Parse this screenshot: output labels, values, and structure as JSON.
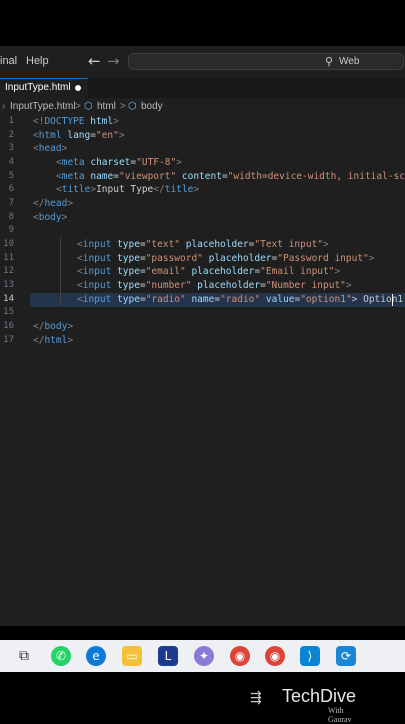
{
  "menu": {
    "terminal_fragment": "inal",
    "help": "Help"
  },
  "search": {
    "text": "Web"
  },
  "tab": {
    "label": "InputType.html"
  },
  "breadcrumb": {
    "file": "InputType.html",
    "sep": ">",
    "html": "html",
    "body": "body"
  },
  "lines": [
    {
      "n": "1"
    },
    {
      "n": "2"
    },
    {
      "n": "3"
    },
    {
      "n": "4"
    },
    {
      "n": "5"
    },
    {
      "n": "6"
    },
    {
      "n": "7"
    },
    {
      "n": "8"
    },
    {
      "n": "9"
    },
    {
      "n": "10"
    },
    {
      "n": "11"
    },
    {
      "n": "12"
    },
    {
      "n": "13"
    },
    {
      "n": "14"
    },
    {
      "n": "15"
    },
    {
      "n": "16"
    },
    {
      "n": "17"
    }
  ],
  "code": {
    "l1": [
      "<!",
      "DOCTYPE",
      " html",
      ">"
    ],
    "l2": [
      "<",
      "html",
      " lang",
      "=",
      "\"en\"",
      ">"
    ],
    "l3": [
      "<",
      "head",
      ">"
    ],
    "l4": [
      "<",
      "meta",
      " charset",
      "=",
      "\"UTF-8\"",
      ">"
    ],
    "l5": [
      "<",
      "meta",
      " name",
      "=",
      "\"viewport\"",
      " content",
      "=",
      "\"width=device-width, initial-scal"
    ],
    "l6": [
      "<",
      "title",
      ">",
      "Input Type",
      "</",
      "title",
      ">"
    ],
    "l7": [
      "</",
      "head",
      ">"
    ],
    "l8": [
      "<",
      "body",
      ">"
    ],
    "l10": [
      "<",
      "input",
      " type",
      "=",
      "\"text\"",
      " placeholder",
      "=",
      "\"Text input\"",
      ">"
    ],
    "l11": [
      "<",
      "input",
      " type",
      "=",
      "\"password\"",
      " placeholder",
      "=",
      "\"Password input\"",
      ">"
    ],
    "l12": [
      "<",
      "input",
      " type",
      "=",
      "\"email\"",
      " placeholder",
      "=",
      "\"Email input\"",
      ">"
    ],
    "l13": [
      "<",
      "input",
      " type",
      "=",
      "\"number\"",
      " placeholder",
      "=",
      "\"Number input\"",
      ">"
    ],
    "l14": [
      "<",
      "input",
      " type",
      "=",
      "\"radio\"",
      " name",
      "=",
      "\"radio\"",
      " value",
      "=",
      "\"option1\"",
      "> Option1"
    ],
    "l16": [
      "</",
      "body",
      ">"
    ],
    "l17": [
      "</",
      "html",
      ">"
    ]
  },
  "brand": {
    "name": "TechDive",
    "sub": "With Gaurav"
  },
  "colors": {
    "editor_bg": "#1f1f1f",
    "tag": "#569cd6",
    "attr": "#9cdcfe",
    "string": "#ce9178",
    "accent": "#0078d4"
  }
}
